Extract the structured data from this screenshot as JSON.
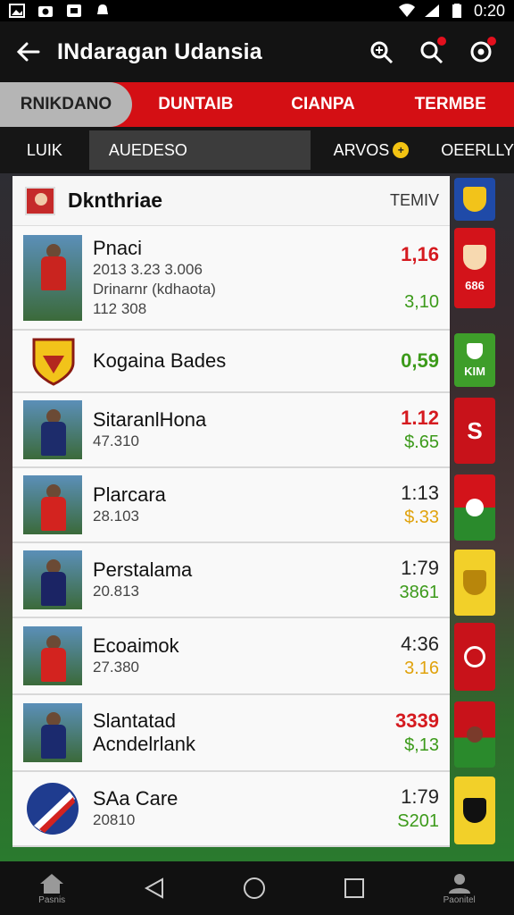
{
  "status_bar": {
    "time": "0:20"
  },
  "app_bar": {
    "title": "INdaragan Udansia"
  },
  "tabs": [
    {
      "label": "RNIKDANO",
      "active": true
    },
    {
      "label": "DUNTAIB",
      "active": false
    },
    {
      "label": "CIANPA",
      "active": false
    },
    {
      "label": "TERMBE",
      "active": false
    }
  ],
  "filters": {
    "left_label": "LUIK",
    "search_value": "AUEDESO",
    "arvos_label": "ARVOS",
    "daily_label": "OEERLLY"
  },
  "list": {
    "header": {
      "title": "Dknthriae",
      "right": "TEMIV"
    },
    "rows": [
      {
        "name": "Pnaci",
        "sub1": "2013 3.23 3.006",
        "sub2": "Drinarnr (kdhaota)",
        "sub3": "112 308",
        "v1": "1,16",
        "v2": "3,10"
      },
      {
        "name": "Kogaina Bades",
        "v2": "0,59"
      },
      {
        "name": "SitaranlHona",
        "sub1": "47.310",
        "v1": "1.12",
        "v2": "$.65"
      },
      {
        "name": "Plarcara",
        "sub1": "28.103",
        "v1": "1:13",
        "v2": "$.33"
      },
      {
        "name": "Perstalama",
        "sub1": "20.813",
        "v1": "1:79",
        "v2": "3861"
      },
      {
        "name": "Ecoaimok",
        "sub1": "27.380",
        "v1": "4:36",
        "v2": "3.16"
      },
      {
        "name": "Slantatad",
        "sub1": "Acndelrlank",
        "v1": "3339",
        "v2": "$,13"
      },
      {
        "name": "SAa Care",
        "sub1": "20810",
        "v1": "1:79",
        "v2": "S201"
      }
    ]
  },
  "badges": [
    {
      "label": ""
    },
    {
      "label": "686"
    },
    {
      "label": "KIM"
    },
    {
      "label": "S"
    },
    {
      "label": ""
    },
    {
      "label": ""
    },
    {
      "label": ""
    },
    {
      "label": ""
    },
    {
      "label": ""
    }
  ],
  "nav": {
    "left_label": "Pasnis",
    "right_label": "Paonitel"
  },
  "colors": {
    "brand_red": "#d40f14",
    "accent_green": "#3c9a1a",
    "accent_gold": "#e0a20c"
  }
}
